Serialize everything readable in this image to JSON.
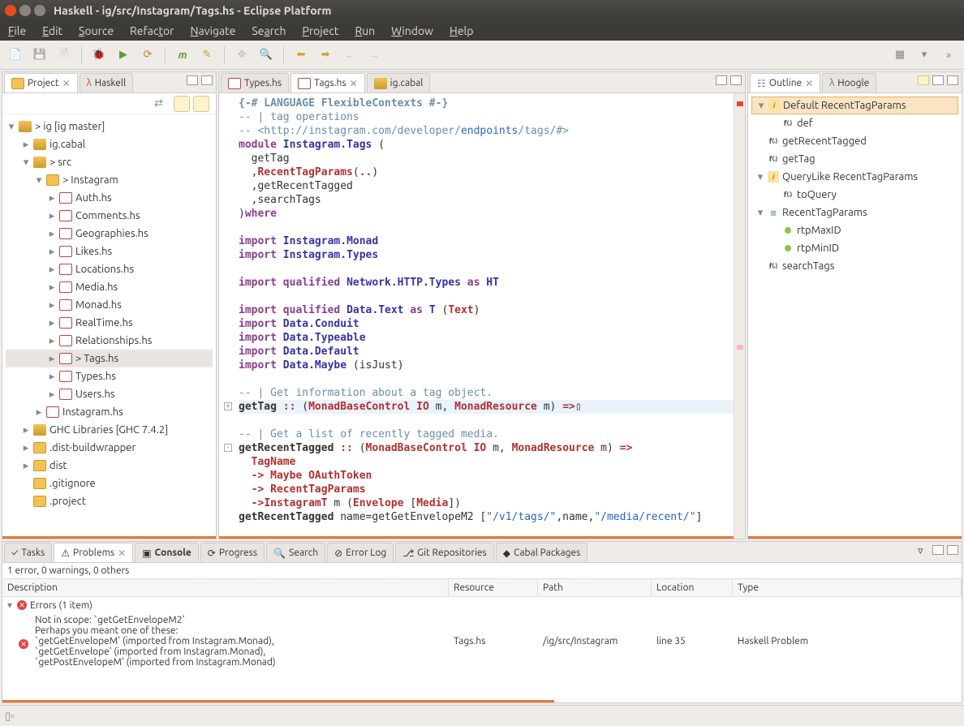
{
  "window": {
    "title": "Haskell - ig/src/Instagram/Tags.hs - Eclipse Platform"
  },
  "menubar": [
    "File",
    "Edit",
    "Source",
    "Refactor",
    "Navigate",
    "Search",
    "Project",
    "Run",
    "Window",
    "Help"
  ],
  "views": {
    "project": {
      "tabs": [
        {
          "label": "Project",
          "active": true
        },
        {
          "label": "Haskell",
          "active": false
        }
      ]
    },
    "editor": {
      "tabs": [
        {
          "label": "Types.hs",
          "active": false
        },
        {
          "label": "Tags.hs",
          "active": true
        },
        {
          "label": "ig.cabal",
          "active": false
        }
      ]
    },
    "outline": {
      "tabs": [
        {
          "label": "Outline",
          "active": true
        },
        {
          "label": "Hoogle",
          "active": false
        }
      ]
    }
  },
  "project_tree": {
    "root": {
      "label": "> ig [ig master]",
      "expanded": true
    },
    "items": [
      {
        "label": "ig.cabal",
        "indent": 1,
        "caret": "▸",
        "type": "pkg"
      },
      {
        "label": "> src",
        "indent": 1,
        "caret": "▾",
        "type": "srcfolder"
      },
      {
        "label": "> Instagram",
        "indent": 2,
        "caret": "▾",
        "type": "folder"
      },
      {
        "label": "Auth.hs",
        "indent": 3,
        "caret": "▸",
        "type": "hs"
      },
      {
        "label": "Comments.hs",
        "indent": 3,
        "caret": "▸",
        "type": "hs"
      },
      {
        "label": "Geographies.hs",
        "indent": 3,
        "caret": "▸",
        "type": "hs"
      },
      {
        "label": "Likes.hs",
        "indent": 3,
        "caret": "▸",
        "type": "hs"
      },
      {
        "label": "Locations.hs",
        "indent": 3,
        "caret": "▸",
        "type": "hs"
      },
      {
        "label": "Media.hs",
        "indent": 3,
        "caret": "▸",
        "type": "hs"
      },
      {
        "label": "Monad.hs",
        "indent": 3,
        "caret": "▸",
        "type": "hs"
      },
      {
        "label": "RealTime.hs",
        "indent": 3,
        "caret": "▸",
        "type": "hs"
      },
      {
        "label": "Relationships.hs",
        "indent": 3,
        "caret": "▸",
        "type": "hs"
      },
      {
        "label": "> Tags.hs",
        "indent": 3,
        "caret": "▸",
        "type": "hs",
        "sel": true
      },
      {
        "label": "Types.hs",
        "indent": 3,
        "caret": "▸",
        "type": "hs"
      },
      {
        "label": "Users.hs",
        "indent": 3,
        "caret": "▸",
        "type": "hs"
      },
      {
        "label": "Instagram.hs",
        "indent": 2,
        "caret": "▸",
        "type": "hs"
      },
      {
        "label": "GHC Libraries [GHC 7.4.2]",
        "indent": 1,
        "caret": "▸",
        "type": "lib"
      },
      {
        "label": ".dist-buildwrapper",
        "indent": 1,
        "caret": "▸",
        "type": "folder"
      },
      {
        "label": "dist",
        "indent": 1,
        "caret": "▸",
        "type": "folder"
      },
      {
        "label": ".gitignore",
        "indent": 1,
        "caret": "",
        "type": "file"
      },
      {
        "label": ".project",
        "indent": 1,
        "caret": "",
        "type": "file"
      }
    ]
  },
  "outline": [
    {
      "label": "Default RecentTagParams",
      "type": "inst",
      "caret": "▾",
      "sel": true
    },
    {
      "label": "def",
      "type": "fn",
      "indent": 1
    },
    {
      "label": "getRecentTagged",
      "type": "fn"
    },
    {
      "label": "getTag",
      "type": "fn"
    },
    {
      "label": "QueryLike RecentTagParams",
      "type": "inst",
      "caret": "▾"
    },
    {
      "label": "toQuery",
      "type": "fn",
      "indent": 1
    },
    {
      "label": "RecentTagParams",
      "type": "data",
      "caret": "▾"
    },
    {
      "label": "rtpMaxID",
      "type": "field",
      "indent": 1
    },
    {
      "label": "rtpMinID",
      "type": "field",
      "indent": 1
    },
    {
      "label": "searchTags",
      "type": "fn"
    }
  ],
  "editor": {
    "lines": [
      [
        {
          "c": "prag",
          "t": "{-# LANGUAGE FlexibleContexts #-}"
        }
      ],
      [
        {
          "c": "cmt",
          "t": "-- | tag operations"
        }
      ],
      [
        {
          "c": "cmt",
          "t": "-- <http://instagram.com/developer/"
        },
        {
          "c": "str",
          "t": "endpoints"
        },
        {
          "c": "cmt",
          "t": "/tags/#>"
        }
      ],
      [
        {
          "c": "kw",
          "t": "module "
        },
        {
          "c": "mod",
          "t": "Instagram.Tags"
        },
        {
          "c": "",
          "t": " ("
        }
      ],
      [
        {
          "c": "",
          "t": "  getTag"
        }
      ],
      [
        {
          "c": "",
          "t": "  ,"
        },
        {
          "c": "ctor",
          "t": "RecentTagParams"
        },
        {
          "c": "",
          "t": "("
        },
        {
          "c": "op",
          "t": ".."
        },
        {
          "c": "",
          "t": ")"
        }
      ],
      [
        {
          "c": "",
          "t": "  ,getRecentTagged"
        }
      ],
      [
        {
          "c": "",
          "t": "  ,searchTags"
        }
      ],
      [
        {
          "c": "",
          "t": ")"
        },
        {
          "c": "kw",
          "t": "where"
        }
      ],
      [],
      [
        {
          "c": "kw",
          "t": "import "
        },
        {
          "c": "mod",
          "t": "Instagram.Monad"
        }
      ],
      [
        {
          "c": "kw",
          "t": "import "
        },
        {
          "c": "mod",
          "t": "Instagram.Types"
        }
      ],
      [],
      [
        {
          "c": "kw",
          "t": "import qualified "
        },
        {
          "c": "mod",
          "t": "Network.HTTP.Types"
        },
        {
          "c": "kw",
          "t": " as "
        },
        {
          "c": "mod",
          "t": "HT"
        }
      ],
      [],
      [
        {
          "c": "kw",
          "t": "import qualified "
        },
        {
          "c": "mod",
          "t": "Data.Text"
        },
        {
          "c": "kw",
          "t": " as "
        },
        {
          "c": "mod",
          "t": "T"
        },
        {
          "c": "",
          "t": " ("
        },
        {
          "c": "typ",
          "t": "Text"
        },
        {
          "c": "",
          "t": ")"
        }
      ],
      [
        {
          "c": "kw",
          "t": "import "
        },
        {
          "c": "mod",
          "t": "Data.Conduit"
        }
      ],
      [
        {
          "c": "kw",
          "t": "import "
        },
        {
          "c": "mod",
          "t": "Data.Typeable"
        }
      ],
      [
        {
          "c": "kw",
          "t": "import "
        },
        {
          "c": "mod",
          "t": "Data.Default"
        }
      ],
      [
        {
          "c": "kw",
          "t": "import "
        },
        {
          "c": "mod",
          "t": "Data.Maybe"
        },
        {
          "c": "",
          "t": " (isJust)"
        }
      ],
      [],
      [
        {
          "c": "cmt",
          "t": "-- | Get information about a tag object."
        }
      ],
      [
        {
          "c": "fn",
          "t": "getTag"
        },
        {
          "c": "",
          "t": " "
        },
        {
          "c": "op",
          "t": "::"
        },
        {
          "c": "",
          "t": " ("
        },
        {
          "c": "typ",
          "t": "MonadBaseControl"
        },
        {
          "c": "",
          "t": " "
        },
        {
          "c": "typ",
          "t": "IO"
        },
        {
          "c": "",
          "t": " m, "
        },
        {
          "c": "typ",
          "t": "MonadResource"
        },
        {
          "c": "",
          "t": " m) "
        },
        {
          "c": "op",
          "t": "=>"
        },
        {
          "c": "",
          "t": "▯"
        }
      ],
      [],
      [
        {
          "c": "cmt",
          "t": "-- | Get a list of recently tagged media."
        }
      ],
      [
        {
          "c": "fn",
          "t": "getRecentTagged"
        },
        {
          "c": "",
          "t": " "
        },
        {
          "c": "op",
          "t": "::"
        },
        {
          "c": "",
          "t": " ("
        },
        {
          "c": "typ",
          "t": "MonadBaseControl"
        },
        {
          "c": "",
          "t": " "
        },
        {
          "c": "typ",
          "t": "IO"
        },
        {
          "c": "",
          "t": " m, "
        },
        {
          "c": "typ",
          "t": "MonadResource"
        },
        {
          "c": "",
          "t": " m) "
        },
        {
          "c": "op",
          "t": "=>"
        }
      ],
      [
        {
          "c": "",
          "t": "  "
        },
        {
          "c": "typ",
          "t": "TagName"
        }
      ],
      [
        {
          "c": "",
          "t": "  "
        },
        {
          "c": "op",
          "t": "->"
        },
        {
          "c": "",
          "t": " "
        },
        {
          "c": "typ",
          "t": "Maybe"
        },
        {
          "c": "",
          "t": " "
        },
        {
          "c": "typ",
          "t": "OAuthToken"
        }
      ],
      [
        {
          "c": "",
          "t": "  "
        },
        {
          "c": "op",
          "t": "->"
        },
        {
          "c": "",
          "t": " "
        },
        {
          "c": "typ",
          "t": "RecentTagParams"
        }
      ],
      [
        {
          "c": "",
          "t": "  "
        },
        {
          "c": "op",
          "t": "->"
        },
        {
          "c": "typ",
          "t": "InstagramT"
        },
        {
          "c": "",
          "t": " m ("
        },
        {
          "c": "typ",
          "t": "Envelope"
        },
        {
          "c": "",
          "t": " ["
        },
        {
          "c": "typ",
          "t": "Media"
        },
        {
          "c": "",
          "t": "])"
        }
      ],
      [
        {
          "c": "fn",
          "t": "getRecentTagged"
        },
        {
          "c": "",
          "t": " name=getGetEnvelopeM2 ["
        },
        {
          "c": "str",
          "t": "\"/v1/tags/\""
        },
        {
          "c": "",
          "t": ",name,"
        },
        {
          "c": "str",
          "t": "\"/media/recent/\""
        },
        {
          "c": "",
          "t": "]"
        }
      ]
    ],
    "current_line_index": 22,
    "fold_markers": [
      {
        "line": 22,
        "sym": "+"
      },
      {
        "line": 25,
        "sym": "-"
      }
    ],
    "error_marker_line": 30
  },
  "bottom": {
    "tabs": [
      {
        "label": "Tasks",
        "icon": "tasks"
      },
      {
        "label": "Problems",
        "icon": "problems",
        "active": true
      },
      {
        "label": "Console",
        "icon": "console",
        "bold": true
      },
      {
        "label": "Progress",
        "icon": "progress"
      },
      {
        "label": "Search",
        "icon": "search"
      },
      {
        "label": "Error Log",
        "icon": "errorlog"
      },
      {
        "label": "Git Repositories",
        "icon": "git"
      },
      {
        "label": "Cabal Packages",
        "icon": "cabal"
      }
    ],
    "summary": "1 error, 0 warnings, 0 others",
    "columns": [
      "Description",
      "Resource",
      "Path",
      "Location",
      "Type"
    ],
    "group": {
      "label": "Errors (1 item)"
    },
    "item": {
      "desc": [
        "Not in scope: `getGetEnvelopeM2'",
        "Perhaps you meant one of these:",
        "  `getGetEnvelopeM' (imported from Instagram.Monad),",
        "  `getGetEnvelope' (imported from Instagram.Monad),",
        "  `getPostEnvelopeM' (imported from Instagram.Monad)"
      ],
      "resource": "Tags.hs",
      "path": "/ig/src/Instagram",
      "location": "line 35",
      "type": "Haskell Problem"
    }
  }
}
